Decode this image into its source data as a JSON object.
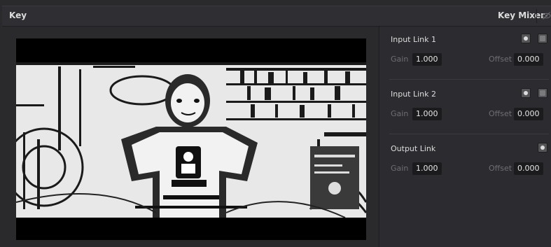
{
  "header": {
    "title": "Key",
    "mode": "Key Mixer",
    "mode_icon": "eye-off-icon"
  },
  "colors": {
    "panel_bg": "#2c2c30",
    "viewer_bg": "#000000",
    "value_field_bg": "#1b1b1d",
    "label_text": "#dcdcdc",
    "dim_text": "#6f6f73"
  },
  "viewer": {
    "content": "inverted high-contrast key matte of a person seated in front of shelves"
  },
  "links": {
    "input1": {
      "label": "Input Link 1",
      "gain_label": "Gain",
      "gain_value": "1.000",
      "offset_label": "Offset",
      "offset_value": "0.000",
      "buttons": [
        "round-toggle-icon",
        "square-toggle-icon"
      ]
    },
    "input2": {
      "label": "Input Link 2",
      "gain_label": "Gain",
      "gain_value": "1.000",
      "offset_label": "Offset",
      "offset_value": "0.000",
      "buttons": [
        "round-toggle-icon",
        "square-toggle-icon"
      ]
    },
    "output": {
      "label": "Output Link",
      "gain_label": "Gain",
      "gain_value": "1.000",
      "offset_label": "Offset",
      "offset_value": "0.000",
      "buttons": [
        "round-toggle-icon"
      ]
    }
  }
}
